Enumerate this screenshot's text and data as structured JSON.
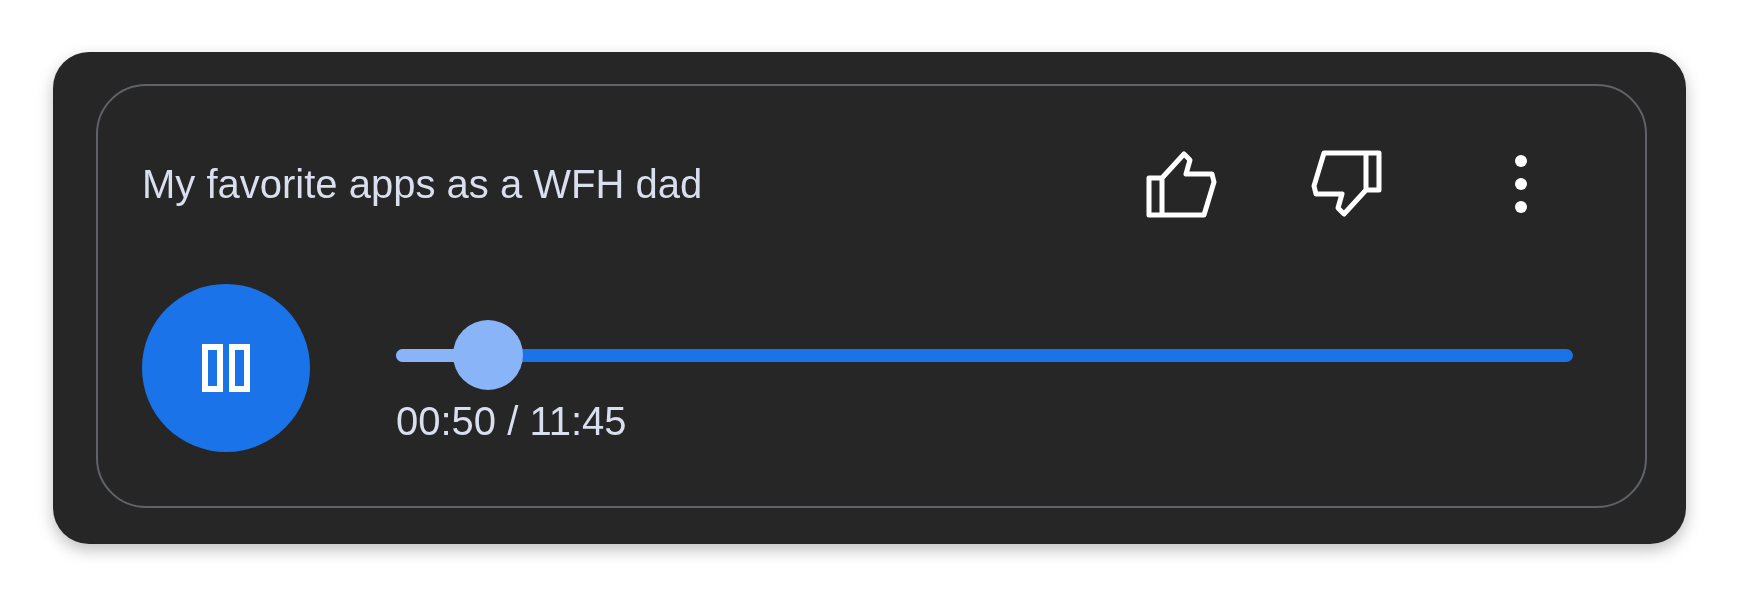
{
  "card": {
    "title": "My favorite apps as a WFH dad"
  },
  "player": {
    "playing": true,
    "level": 0.078,
    "time": "00:50 / 11:45"
  }
}
